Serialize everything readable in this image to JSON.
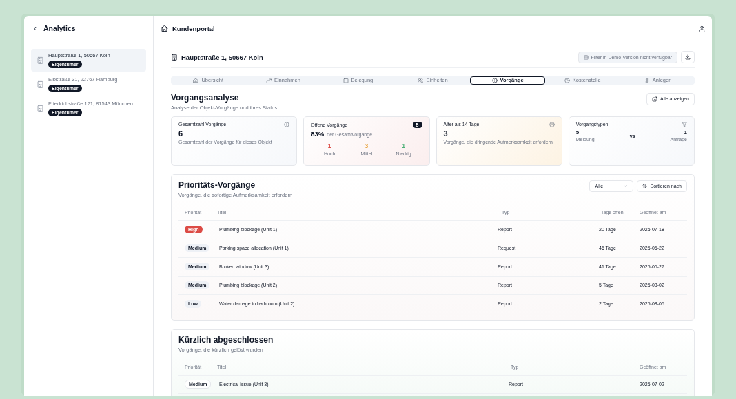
{
  "sidebar": {
    "back": "‹",
    "title": "Analytics",
    "items": [
      {
        "address": "Hauptstraße 1, 50667 Köln",
        "role": "Eigentümer",
        "selected": true
      },
      {
        "address": "Elbstraße 31, 22767 Hamburg",
        "role": "Eigentümer",
        "selected": false
      },
      {
        "address": "Friedrichstraße 121, 81543 München",
        "role": "Eigentümer",
        "selected": false
      }
    ]
  },
  "header": {
    "title": "Kundenportal"
  },
  "property": {
    "title": "Hauptstraße 1, 50667 Köln",
    "filter_button": "Filter in Demo-Version nicht verfügbar"
  },
  "tabs": [
    {
      "label": "Übersicht",
      "selected": false
    },
    {
      "label": "Einnahmen",
      "selected": false
    },
    {
      "label": "Belegung",
      "selected": false
    },
    {
      "label": "Einheiten",
      "selected": false
    },
    {
      "label": "Vorgänge",
      "selected": true
    },
    {
      "label": "Kostenstelle",
      "selected": false
    },
    {
      "label": "Anleger",
      "selected": false
    }
  ],
  "analysis": {
    "title": "Vorgangsanalyse",
    "subtitle": "Analyse der Objekt-Vorgänge und ihres Status",
    "show_all": "Alle anzeigen"
  },
  "cards": {
    "total": {
      "title": "Gesamtzahl Vorgänge",
      "value": "6",
      "note": "Gesamtzahl der Vorgänge für dieses Objekt"
    },
    "open": {
      "title": "Offene Vorgänge",
      "badge": "5",
      "percent": "83%",
      "percent_note": "der Gesamtvorgänge",
      "breakdown": [
        {
          "value": "1",
          "label": "Hoch",
          "color": "#dc4b45"
        },
        {
          "value": "3",
          "label": "Mittel",
          "color": "#e8a23a"
        },
        {
          "value": "1",
          "label": "Niedrig",
          "color": "#4caf76"
        }
      ]
    },
    "older": {
      "title": "Älter als 14 Tage",
      "value": "3",
      "note": "Vorgänge, die dringende Aufmerksamkeit erfordern"
    },
    "types": {
      "title": "Vorgangstypen",
      "left_value": "5",
      "left_label": "Meldung",
      "vs": "vs",
      "right_value": "1",
      "right_label": "Anfrage"
    }
  },
  "priority": {
    "title": "Prioritäts-Vorgänge",
    "subtitle": "Vorgänge, die sofortige Aufmerksamkeit erfordern",
    "select": "Alle",
    "sort_button": "Sortieren nach",
    "columns": [
      "Priorität",
      "Titel",
      "Typ",
      "Tage offen",
      "Geöffnet am"
    ],
    "rows": [
      {
        "priority": "High",
        "kind": "high",
        "title": "Plumbing blockage (Unit 1)",
        "type": "Report",
        "days": "20 Tage",
        "opened": "2025-07-18"
      },
      {
        "priority": "Medium",
        "kind": "medium",
        "title": "Parking space allocation (Unit 1)",
        "type": "Request",
        "days": "46 Tage",
        "opened": "2025-06-22"
      },
      {
        "priority": "Medium",
        "kind": "medium",
        "title": "Broken window (Unit 3)",
        "type": "Report",
        "days": "41 Tage",
        "opened": "2025-06-27"
      },
      {
        "priority": "Medium",
        "kind": "medium",
        "title": "Plumbing blockage (Unit 2)",
        "type": "Report",
        "days": "5 Tage",
        "opened": "2025-08-02"
      },
      {
        "priority": "Low",
        "kind": "low",
        "title": "Water damage in bathroom (Unit 2)",
        "type": "Report",
        "days": "2 Tage",
        "opened": "2025-08-05"
      }
    ]
  },
  "closed": {
    "title": "Kürzlich abgeschlossen",
    "subtitle": "Vorgänge, die kürzlich gelöst wurden",
    "columns": [
      "Priorität",
      "Titel",
      "Typ",
      "Geöffnet am"
    ],
    "rows": [
      {
        "priority": "Medium",
        "kind": "medium",
        "title": "Electrical issue (Unit 3)",
        "type": "Report",
        "opened": "2025-07-02"
      }
    ]
  }
}
